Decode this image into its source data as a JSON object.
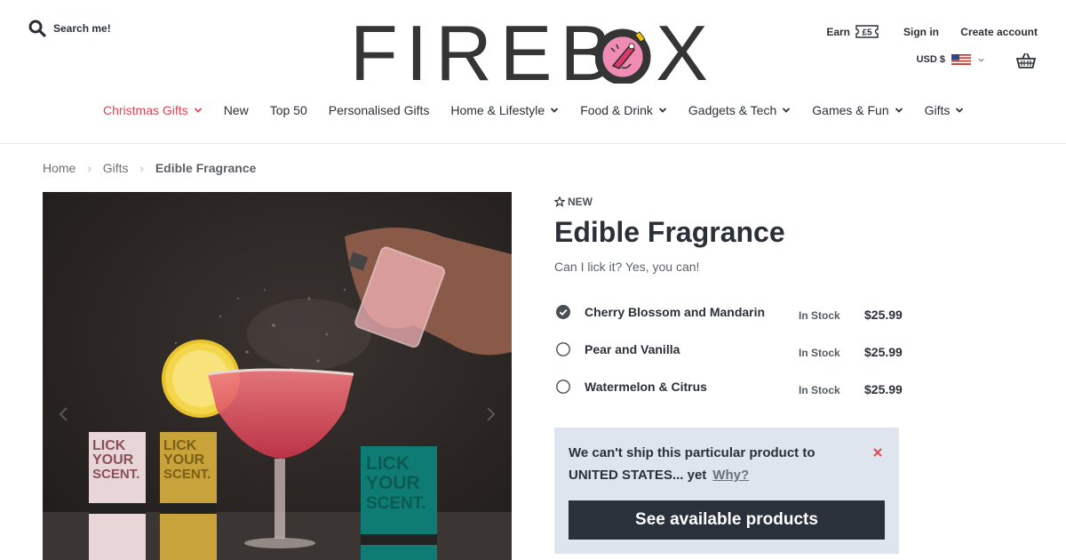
{
  "header": {
    "search_label": "Search me!",
    "logo_text": "FIREB",
    "logo_text_end": "X",
    "earn_label": "Earn",
    "earn_badge": "£5",
    "signin_label": "Sign in",
    "create_account_label": "Create account",
    "currency_label": "USD $"
  },
  "nav": [
    {
      "label": "Christmas Gifts",
      "dropdown": true,
      "highlight": true
    },
    {
      "label": "New",
      "dropdown": false
    },
    {
      "label": "Top 50",
      "dropdown": false
    },
    {
      "label": "Personalised Gifts",
      "dropdown": false
    },
    {
      "label": "Home & Lifestyle",
      "dropdown": true
    },
    {
      "label": "Food & Drink",
      "dropdown": true
    },
    {
      "label": "Gadgets & Tech",
      "dropdown": true
    },
    {
      "label": "Games & Fun",
      "dropdown": true
    },
    {
      "label": "Gifts",
      "dropdown": true
    }
  ],
  "breadcrumb": [
    "Home",
    "Gifts",
    "Edible Fragrance"
  ],
  "product": {
    "badge": "NEW",
    "title": "Edible Fragrance",
    "subtitle": "Can I lick it? Yes, you can!",
    "variants": [
      {
        "name": "Cherry Blossom and Mandarin",
        "stock": "In Stock",
        "price": "$25.99",
        "selected": true
      },
      {
        "name": "Pear and Vanilla",
        "stock": "In Stock",
        "price": "$25.99",
        "selected": false
      },
      {
        "name": "Watermelon & Citrus",
        "stock": "In Stock",
        "price": "$25.99",
        "selected": false
      }
    ]
  },
  "shipping": {
    "message": "We can't ship this particular product to UNITED STATES... yet",
    "why_label": "Why?",
    "button_label": "See available products"
  },
  "gallery": {
    "box_text_lines": [
      "LICK",
      "YOUR",
      "SCENT."
    ]
  },
  "colors": {
    "accent_red": "#e0454f",
    "dark_button": "#2a313b",
    "notice_bg": "#dfe5ee",
    "logo_pink": "#f08cb4"
  },
  "icons": {
    "search": "search-icon",
    "basket": "basket-icon",
    "flag": "us-flag-icon",
    "star": "star-icon",
    "close": "close-icon"
  }
}
